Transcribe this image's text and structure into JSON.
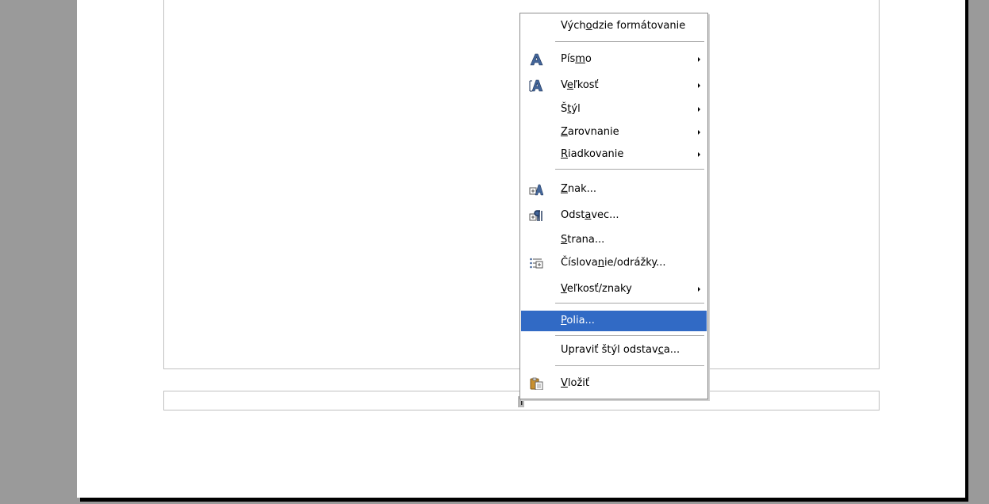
{
  "menu": {
    "items": [
      {
        "pre": "Vých",
        "mn": "o",
        "post": "dzie formátovanie",
        "has_sub": false,
        "icon": ""
      },
      {
        "pre": "Pís",
        "mn": "m",
        "post": "o",
        "has_sub": true,
        "icon": "font-icon"
      },
      {
        "pre": "V",
        "mn": "e",
        "post": "ľkosť",
        "has_sub": true,
        "icon": "font-size-icon"
      },
      {
        "pre": "Š",
        "mn": "t",
        "post": "ýl",
        "has_sub": true,
        "icon": ""
      },
      {
        "pre": "",
        "mn": "Z",
        "post": "arovnanie",
        "has_sub": true,
        "icon": ""
      },
      {
        "pre": "",
        "mn": "R",
        "post": "iadkovanie",
        "has_sub": true,
        "icon": ""
      },
      {
        "pre": "",
        "mn": "Z",
        "post": "nak...",
        "has_sub": false,
        "icon": "character-icon"
      },
      {
        "pre": "Odst",
        "mn": "a",
        "post": "vec...",
        "has_sub": false,
        "icon": "paragraph-icon"
      },
      {
        "pre": "",
        "mn": "S",
        "post": "trana...",
        "has_sub": false,
        "icon": ""
      },
      {
        "pre": "Číslova",
        "mn": "n",
        "post": "ie/odrážky...",
        "has_sub": false,
        "icon": "numbering-icon"
      },
      {
        "pre": "",
        "mn": "V",
        "post": "eľkosť/znaky",
        "has_sub": true,
        "icon": ""
      },
      {
        "pre": "",
        "mn": "P",
        "post": "olia...",
        "has_sub": false,
        "icon": "",
        "selected": true
      },
      {
        "pre": "Upraviť štýl odstav",
        "mn": "c",
        "post": "a...",
        "has_sub": false,
        "icon": ""
      },
      {
        "pre": "",
        "mn": "V",
        "post": "ložiť",
        "has_sub": false,
        "icon": "paste-icon"
      }
    ]
  },
  "colors": {
    "selection": "#316ac5",
    "background": "#9a9a9a",
    "page": "#ffffff"
  },
  "cursor": {
    "glyph": "I"
  }
}
